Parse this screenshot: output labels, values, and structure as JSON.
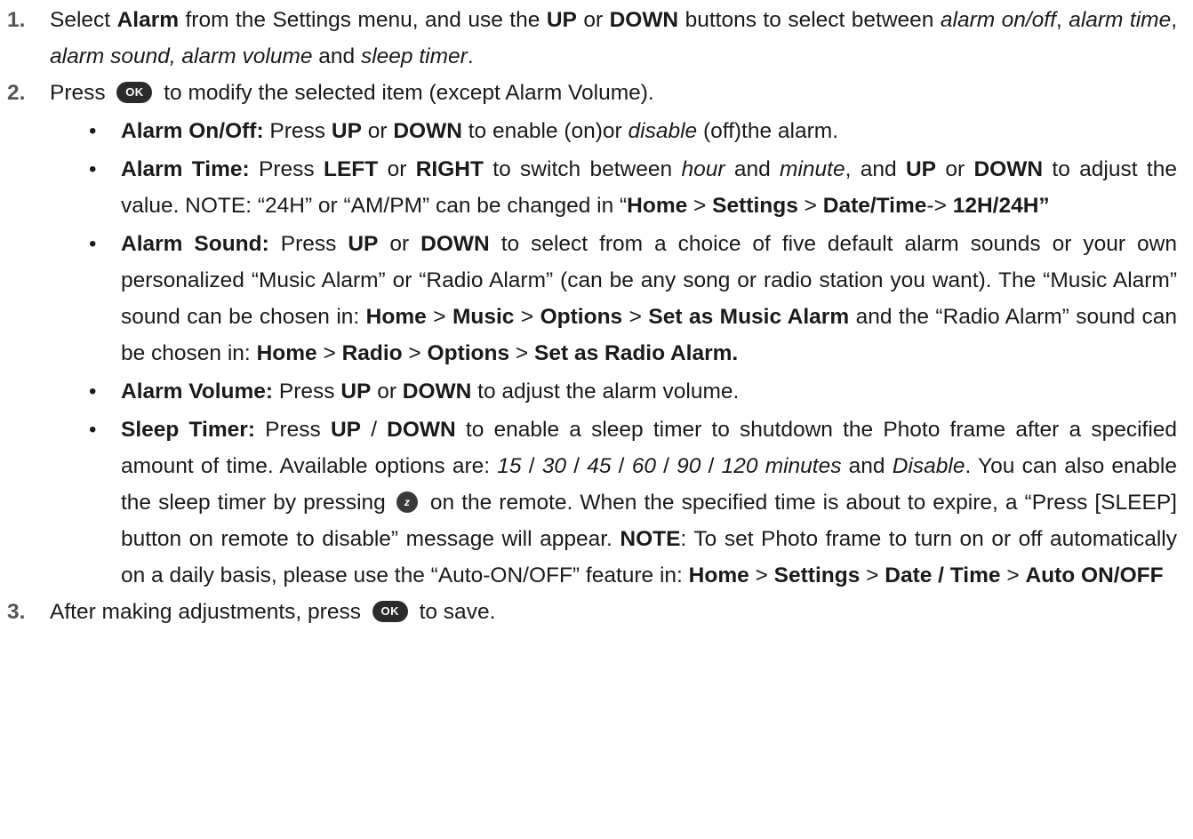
{
  "steps": [
    {
      "num": "1.",
      "parts": [
        {
          "t": "Select "
        },
        {
          "t": "Alarm",
          "b": true
        },
        {
          "t": " from the Settings menu, and use the "
        },
        {
          "t": "UP",
          "b": true
        },
        {
          "t": " or "
        },
        {
          "t": "DOWN",
          "b": true
        },
        {
          "t": " buttons to select between "
        },
        {
          "t": "alarm on/off",
          "i": true
        },
        {
          "t": ", "
        },
        {
          "t": "alarm time",
          "i": true
        },
        {
          "t": ", "
        },
        {
          "t": "alarm sound, alarm volume",
          "i": true
        },
        {
          "t": " and "
        },
        {
          "t": "sleep timer",
          "i": true
        },
        {
          "t": "."
        }
      ]
    },
    {
      "num": "2.",
      "parts": [
        {
          "t": "Press "
        },
        {
          "icon": "ok-button-icon",
          "label": "OK"
        },
        {
          "t": " to modify the selected item (except Alarm Volume)."
        }
      ],
      "bullets": [
        [
          {
            "t": "Alarm On/Off:",
            "b": true
          },
          {
            "t": " Press "
          },
          {
            "t": "UP",
            "b": true
          },
          {
            "t": " or "
          },
          {
            "t": "DOWN",
            "b": true
          },
          {
            "t": " to enable (on)or "
          },
          {
            "t": "disable",
            "i": true
          },
          {
            "t": " (off)the alarm."
          }
        ],
        [
          {
            "t": "Alarm Time:",
            "b": true
          },
          {
            "t": " Press "
          },
          {
            "t": "LEFT",
            "b": true
          },
          {
            "t": " or "
          },
          {
            "t": "RIGHT",
            "b": true
          },
          {
            "t": " to switch between "
          },
          {
            "t": "hour",
            "i": true
          },
          {
            "t": " and "
          },
          {
            "t": "minute",
            "i": true
          },
          {
            "t": ", and "
          },
          {
            "t": "UP",
            "b": true
          },
          {
            "t": " or "
          },
          {
            "t": "DOWN",
            "b": true
          },
          {
            "t": " to adjust the value. NOTE: “24H” or “AM/PM” can be changed in “"
          },
          {
            "t": "Home",
            "b": true
          },
          {
            "t": " > "
          },
          {
            "t": "Settings",
            "b": true
          },
          {
            "t": " > "
          },
          {
            "t": "Date/Time",
            "b": true
          },
          {
            "t": "-> "
          },
          {
            "t": "12H/24H”",
            "b": true
          }
        ],
        [
          {
            "t": "Alarm Sound:",
            "b": true
          },
          {
            "t": " Press "
          },
          {
            "t": "UP",
            "b": true
          },
          {
            "t": " or "
          },
          {
            "t": "DOWN",
            "b": true
          },
          {
            "t": " to select from a choice of five default alarm sounds or your own personalized “Music Alarm” or “Radio Alarm” (can be any song or radio station you want). The “Music Alarm” sound can be chosen in: "
          },
          {
            "t": "Home",
            "b": true
          },
          {
            "t": " > "
          },
          {
            "t": "Music",
            "b": true
          },
          {
            "t": " > "
          },
          {
            "t": "Options",
            "b": true
          },
          {
            "t": " > "
          },
          {
            "t": "Set as Music Alarm",
            "b": true
          },
          {
            "t": " and the “Radio Alarm” sound can be chosen in: "
          },
          {
            "t": "Home",
            "b": true
          },
          {
            "t": " > "
          },
          {
            "t": "Radio",
            "b": true
          },
          {
            "t": " > "
          },
          {
            "t": "Options",
            "b": true
          },
          {
            "t": " > "
          },
          {
            "t": "Set as Radio Alarm.",
            "b": true
          }
        ],
        [
          {
            "t": "Alarm Volume:",
            "b": true
          },
          {
            "t": " Press "
          },
          {
            "t": "UP",
            "b": true
          },
          {
            "t": " or "
          },
          {
            "t": "DOWN",
            "b": true
          },
          {
            "t": " to adjust the alarm volume."
          }
        ],
        [
          {
            "t": "Sleep Timer:",
            "b": true
          },
          {
            "t": " Press "
          },
          {
            "t": "UP",
            "b": true
          },
          {
            "t": " / "
          },
          {
            "t": "DOWN",
            "b": true
          },
          {
            "t": " to enable a sleep timer to shutdown the Photo frame after a specified amount of time. Available options are: "
          },
          {
            "t": "15",
            "i": true
          },
          {
            "t": " / "
          },
          {
            "t": "30",
            "i": true
          },
          {
            "t": " / "
          },
          {
            "t": "45",
            "i": true
          },
          {
            "t": " / "
          },
          {
            "t": "60",
            "i": true
          },
          {
            "t": " / "
          },
          {
            "t": "90",
            "i": true
          },
          {
            "t": " / "
          },
          {
            "t": "120 minutes",
            "i": true
          },
          {
            "t": " and "
          },
          {
            "t": "Disable",
            "i": true
          },
          {
            "t": ". You can also enable the sleep timer by pressing "
          },
          {
            "icon": "sleep-button-icon",
            "label": "z"
          },
          {
            "t": " on the remote. When the specified time is about to expire, a “Press [SLEEP] button on remote to disable” message will appear. "
          },
          {
            "t": "NOTE",
            "b": true
          },
          {
            "t": ": To set Photo frame to turn on or off automatically on a daily basis, please use the “Auto-ON/OFF” feature in: "
          },
          {
            "t": "Home",
            "b": true
          },
          {
            "t": " > "
          },
          {
            "t": "Settings",
            "b": true
          },
          {
            "t": " > "
          },
          {
            "t": "Date / Time",
            "b": true
          },
          {
            "t": " > "
          },
          {
            "t": "Auto ON/OFF",
            "b": true
          }
        ]
      ]
    },
    {
      "num": "3.",
      "parts": [
        {
          "t": "After making adjustments, press "
        },
        {
          "icon": "ok-button-icon",
          "label": "OK"
        },
        {
          "t": " to save."
        }
      ]
    }
  ]
}
